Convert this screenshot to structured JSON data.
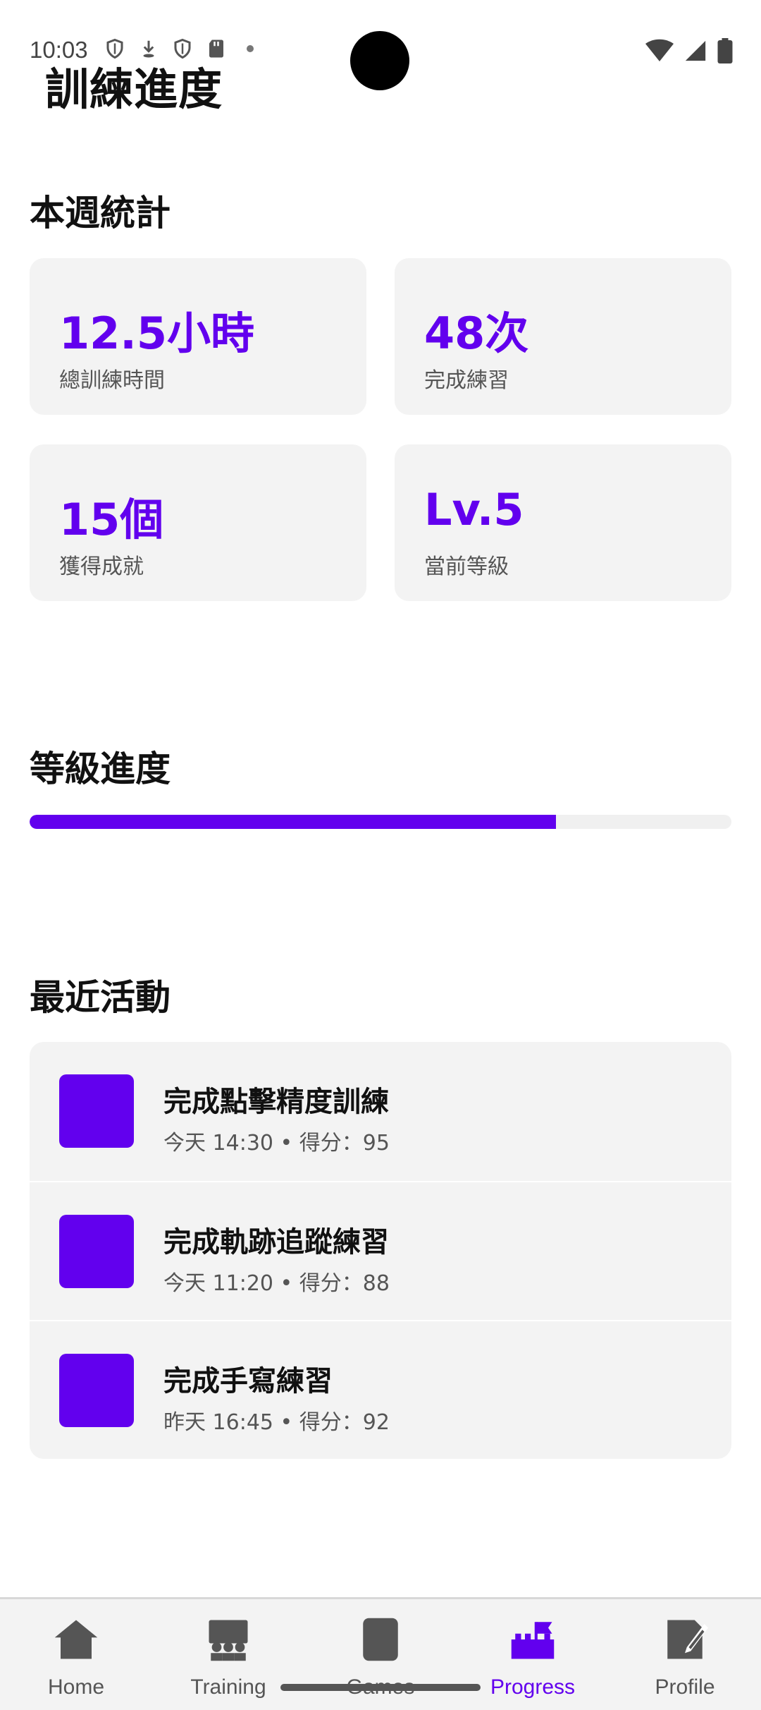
{
  "status_bar": {
    "time": "10:03"
  },
  "page_title": "訓練進度",
  "weekly_stats": {
    "title": "本週統計",
    "cards": [
      {
        "value": "12.5小時",
        "label": "總訓練時間"
      },
      {
        "value": "48次",
        "label": "完成練習"
      },
      {
        "value": "15個",
        "label": "獲得成就"
      },
      {
        "value": "Lv.5",
        "label": "當前等級"
      }
    ]
  },
  "level_progress": {
    "title": "等級進度",
    "progress": 0.75
  },
  "recent_activity": {
    "title": "最近活動",
    "items": [
      {
        "title": "完成點擊精度訓練",
        "meta": "今天 14:30 • 得分：95"
      },
      {
        "title": "完成軌跡追蹤練習",
        "meta": "今天 11:20 • 得分：88"
      },
      {
        "title": "完成手寫練習",
        "meta": "昨天 16:45 • 得分：92"
      }
    ]
  },
  "bottom_nav": {
    "items": [
      {
        "label": "Home",
        "icon": "home-icon",
        "active": false
      },
      {
        "label": "Training",
        "icon": "training-icon",
        "active": false
      },
      {
        "label": "Games",
        "icon": "games-icon",
        "active": false
      },
      {
        "label": "Progress",
        "icon": "progress-icon",
        "active": true
      },
      {
        "label": "Profile",
        "icon": "profile-icon",
        "active": false
      }
    ]
  },
  "colors": {
    "accent": "#6200ee",
    "card_bg": "#f3f3f3",
    "nav_inactive": "#555555"
  }
}
